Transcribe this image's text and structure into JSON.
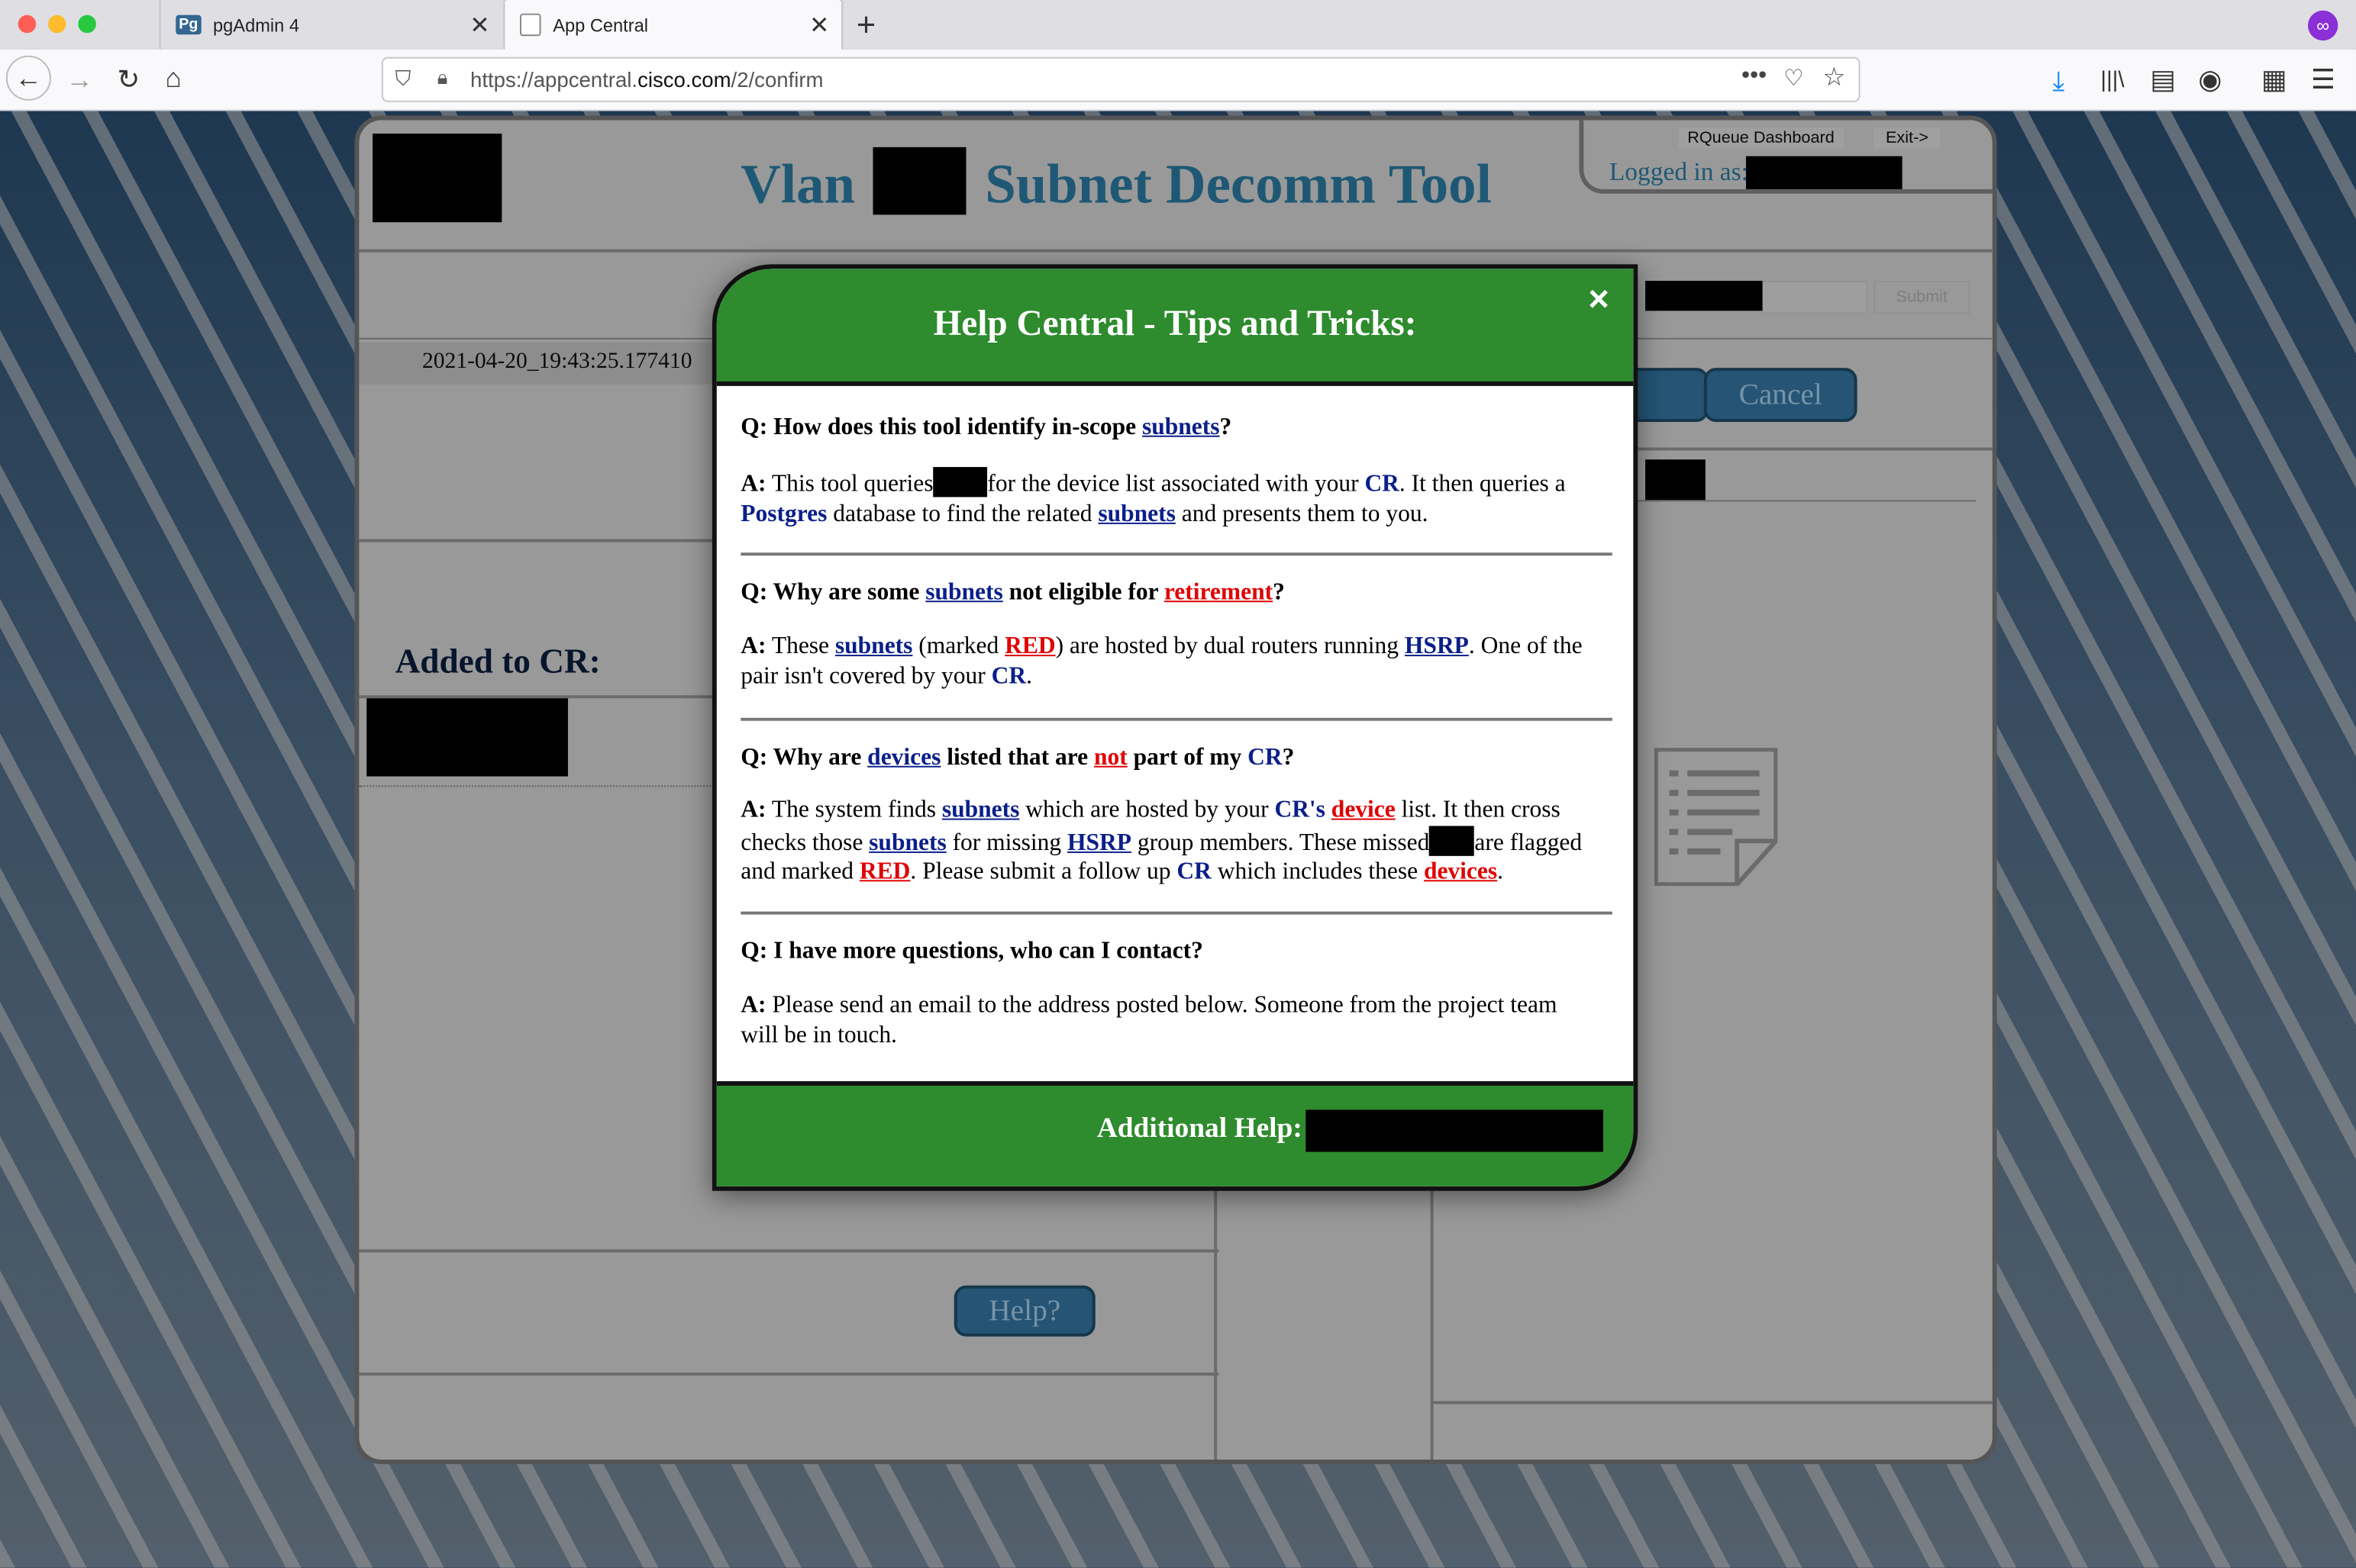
{
  "browser": {
    "tabs": [
      {
        "label": "pgAdmin 4",
        "icon": "Pg"
      },
      {
        "label": "App Central"
      }
    ],
    "url_prefix": "https://appcentral.",
    "url_host": "cisco.com",
    "url_path": "/2/confirm"
  },
  "app": {
    "title_left": "Vlan",
    "title_right": "Subnet Decomm Tool",
    "top_menu": {
      "dashboard": "RQueue Dashboard",
      "exit": "Exit->"
    },
    "logged_in_label": "Logged in as:",
    "submit_label": "Submit",
    "timestamp": "2021-04-20_19:43:25.177410",
    "cancel_label": "Cancel",
    "added_to_cr": "Added to CR:",
    "help_label": "Help?"
  },
  "modal": {
    "title": "Help Central - Tips and Tricks:",
    "close_icon": "×",
    "footer_label": "Additional Help:",
    "q1": {
      "q_prefix": "Q: How does this tool identify in-scope ",
      "q_link": "subnets",
      "q_suffix": "?",
      "a_label": "A:",
      "a1": "This tool queries",
      "a2": "for the device list associated with your",
      "cr": "CR",
      "a3": ". It then queries a",
      "postgres": "Postgres",
      "a4": "database to find the related",
      "subnets": "subnets",
      "a5": "and presents them to you."
    },
    "q2": {
      "q_prefix": "Q: Why are some ",
      "q_link": "subnets",
      "q_mid": " not eligible for ",
      "q_red": "retirement",
      "q_suffix": "?",
      "a_label": "A:",
      "a1": "These",
      "subnets": "subnets",
      "a2": "(marked",
      "red": "RED",
      "a3": ") are hosted by dual routers running",
      "hsrp": "HSRP",
      "a4": ". One of the",
      "a5": "pair isn't covered by your",
      "cr": "CR",
      "a6": "."
    },
    "q3": {
      "q_prefix": "Q: Why are ",
      "q_link": "devices",
      "q_mid": " listed that are ",
      "q_red": "not",
      "q_mid2": " part of my ",
      "q_cr": "CR",
      "q_suffix": "?",
      "a_label": "A:",
      "a1": "The system finds",
      "subnets": "subnets",
      "a2": "which are hosted by your",
      "crs": "CR's",
      "device": "device",
      "a3": "list. It then cross",
      "a4": "checks those",
      "subnets2": "subnets",
      "a5": "for missing",
      "hsrp": "HSRP",
      "a6": "group members. These missed",
      "a7": "are flagged",
      "a8": "and marked",
      "red": "RED",
      "a9": ". Please submit a follow up",
      "cr": "CR",
      "a10": "which includes these",
      "devices": "devices",
      "a11": "."
    },
    "q4": {
      "q": "Q: I have more questions, who can I contact?",
      "a_label": "A:",
      "a1": "Please send an email to the address posted below. Someone from the project team",
      "a2": "will be in touch."
    }
  }
}
